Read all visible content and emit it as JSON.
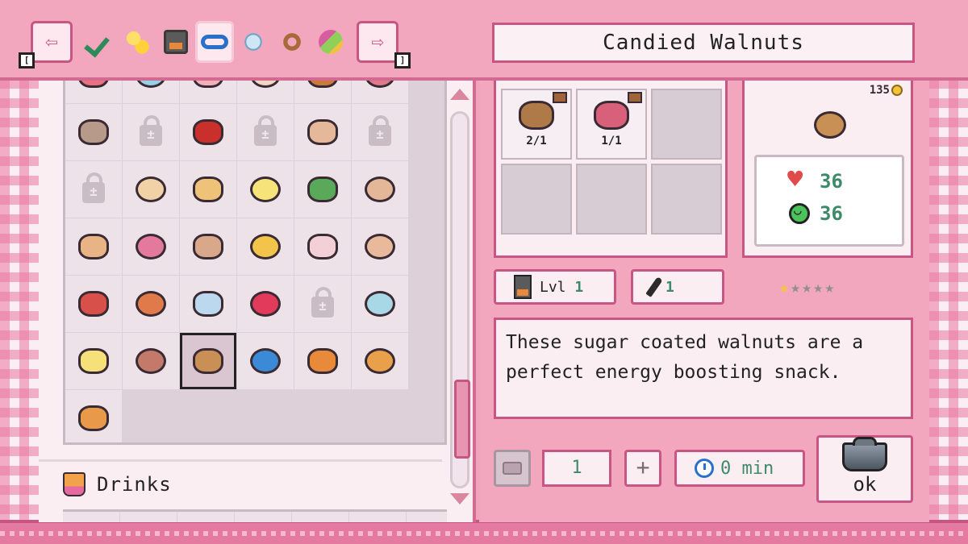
{
  "header": {
    "prev_key": "[",
    "next_key": "]",
    "prev_arrow": "⇦",
    "next_arrow": "⇨",
    "category_tabs": [
      {
        "icon": "check-icon",
        "active": false
      },
      {
        "icon": "stars-icon",
        "active": false
      },
      {
        "icon": "oven-icon",
        "active": false
      },
      {
        "icon": "infinity-icon",
        "active": true
      },
      {
        "icon": "ice-icon",
        "active": false
      },
      {
        "icon": "pretzel-icon",
        "active": false
      },
      {
        "icon": "vegetable-icon",
        "active": false
      }
    ],
    "recipe_title": "Candied Walnuts"
  },
  "recipe_grid": {
    "columns": 6,
    "cells": [
      {
        "type": "food",
        "color": "#e8707f"
      },
      {
        "type": "food",
        "color": "#9ad0e6"
      },
      {
        "type": "food",
        "color": "#f3b0b8"
      },
      {
        "type": "food",
        "color": "#f1d6c4"
      },
      {
        "type": "food",
        "color": "#c97a3a"
      },
      {
        "type": "food",
        "color": "#e07a8a"
      },
      {
        "type": "food",
        "color": "#b89a8a"
      },
      {
        "type": "lock"
      },
      {
        "type": "food",
        "color": "#c9302c"
      },
      {
        "type": "lock"
      },
      {
        "type": "food",
        "color": "#e6b89a"
      },
      {
        "type": "lock"
      },
      {
        "type": "lock"
      },
      {
        "type": "food",
        "color": "#f0d2a6"
      },
      {
        "type": "food",
        "color": "#efc27a"
      },
      {
        "type": "food",
        "color": "#f6e37a"
      },
      {
        "type": "food",
        "color": "#5aa85a"
      },
      {
        "type": "food",
        "color": "#e3b797"
      },
      {
        "type": "food",
        "color": "#e8b486"
      },
      {
        "type": "food",
        "color": "#e37a9e"
      },
      {
        "type": "food",
        "color": "#d9a88a"
      },
      {
        "type": "food",
        "color": "#f2c54a"
      },
      {
        "type": "food",
        "color": "#f3d0d8"
      },
      {
        "type": "food",
        "color": "#e8b99a"
      },
      {
        "type": "food",
        "color": "#d8504a"
      },
      {
        "type": "food",
        "color": "#e07a4a"
      },
      {
        "type": "food",
        "color": "#bcd8ee"
      },
      {
        "type": "food",
        "color": "#e23a5a"
      },
      {
        "type": "lock"
      },
      {
        "type": "food",
        "color": "#a8d8e6"
      },
      {
        "type": "food",
        "color": "#f6e07a"
      },
      {
        "type": "food",
        "color": "#c47a6a"
      },
      {
        "type": "food",
        "color": "#c99055",
        "selected": true
      },
      {
        "type": "food",
        "color": "#3a8ad8"
      },
      {
        "type": "food",
        "color": "#e88a3a"
      },
      {
        "type": "food",
        "color": "#e8a04a"
      },
      {
        "type": "food",
        "color": "#e89a4a"
      },
      {
        "type": "empty"
      },
      {
        "type": "empty"
      },
      {
        "type": "empty"
      },
      {
        "type": "empty"
      },
      {
        "type": "empty"
      }
    ]
  },
  "drinks": {
    "label": "Drinks"
  },
  "ingredients": [
    {
      "icon": "walnut-icon",
      "qty": "2/1",
      "color": "#b07a48",
      "filled": true
    },
    {
      "icon": "sugar-box-icon",
      "qty": "1/1",
      "color": "#d8607a",
      "filled": true
    },
    {
      "filled": false
    },
    {
      "filled": false
    },
    {
      "filled": false
    },
    {
      "filled": false
    }
  ],
  "preview": {
    "price": "135",
    "health": "36",
    "energy": "36"
  },
  "info": {
    "level_label": "Lvl",
    "level_value": "1",
    "tool_value": "1",
    "stars": [
      "★",
      "★",
      "★",
      "★",
      "★"
    ],
    "stars_filled": 1
  },
  "description": "These sugar coated walnuts are a perfect energy boosting snack.",
  "controls": {
    "quantity": "1",
    "plus": "+",
    "time": "0 min",
    "ok_label": "ok"
  },
  "colors": {
    "accent": "#c95583",
    "panel": "#fbeef3",
    "value_green": "#3d8a6a"
  }
}
